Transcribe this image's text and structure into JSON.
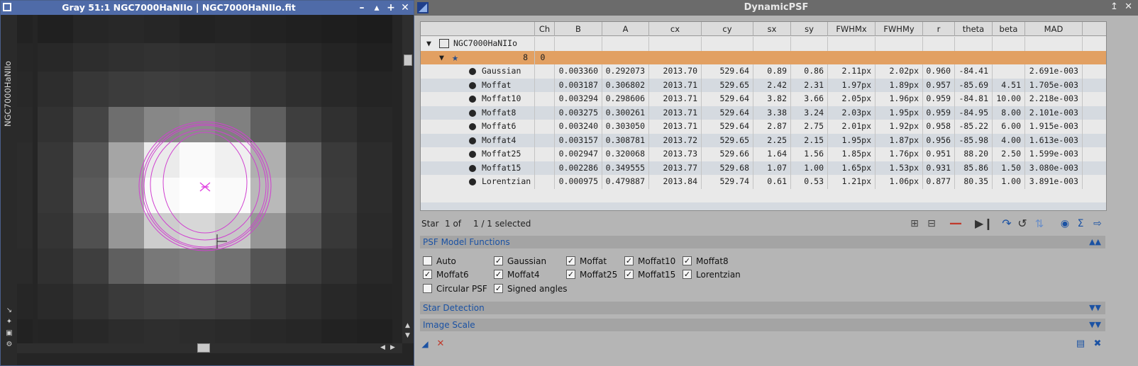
{
  "image_window": {
    "title": "Gray 51:1 NGC7000HaNIIo | NGC7000HaNIIo.fit",
    "view_id": "NGC7000HaNIIo",
    "buttons": {
      "minimize": "–",
      "shade": "▴",
      "maximize": "+",
      "close": "✕"
    }
  },
  "psf_window": {
    "title": "DynamicPSF",
    "columns": [
      "",
      "Ch",
      "B",
      "A",
      "cx",
      "cy",
      "sx",
      "sy",
      "FWHMx",
      "FWHMy",
      "r",
      "theta",
      "beta",
      "MAD"
    ],
    "tree": {
      "image_label": "NGC7000HaNIIo",
      "star_row": {
        "index": "8",
        "channel": "0"
      }
    },
    "rows": [
      {
        "name": "Gaussian",
        "B": "0.003360",
        "A": "0.292073",
        "cx": "2013.70",
        "cy": "529.64",
        "sx": "0.89",
        "sy": "0.86",
        "FWHMx": "2.11px",
        "FWHMy": "2.02px",
        "r": "0.960",
        "theta": "-84.41",
        "beta": "",
        "MAD": "2.691e-003"
      },
      {
        "name": "Moffat",
        "B": "0.003187",
        "A": "0.306802",
        "cx": "2013.71",
        "cy": "529.65",
        "sx": "2.42",
        "sy": "2.31",
        "FWHMx": "1.97px",
        "FWHMy": "1.89px",
        "r": "0.957",
        "theta": "-85.69",
        "beta": "4.51",
        "MAD": "1.705e-003"
      },
      {
        "name": "Moffat10",
        "B": "0.003294",
        "A": "0.298606",
        "cx": "2013.71",
        "cy": "529.64",
        "sx": "3.82",
        "sy": "3.66",
        "FWHMx": "2.05px",
        "FWHMy": "1.96px",
        "r": "0.959",
        "theta": "-84.81",
        "beta": "10.00",
        "MAD": "2.218e-003"
      },
      {
        "name": "Moffat8",
        "B": "0.003275",
        "A": "0.300261",
        "cx": "2013.71",
        "cy": "529.64",
        "sx": "3.38",
        "sy": "3.24",
        "FWHMx": "2.03px",
        "FWHMy": "1.95px",
        "r": "0.959",
        "theta": "-84.95",
        "beta": "8.00",
        "MAD": "2.101e-003"
      },
      {
        "name": "Moffat6",
        "B": "0.003240",
        "A": "0.303050",
        "cx": "2013.71",
        "cy": "529.64",
        "sx": "2.87",
        "sy": "2.75",
        "FWHMx": "2.01px",
        "FWHMy": "1.92px",
        "r": "0.958",
        "theta": "-85.22",
        "beta": "6.00",
        "MAD": "1.915e-003"
      },
      {
        "name": "Moffat4",
        "B": "0.003157",
        "A": "0.308781",
        "cx": "2013.72",
        "cy": "529.65",
        "sx": "2.25",
        "sy": "2.15",
        "FWHMx": "1.95px",
        "FWHMy": "1.87px",
        "r": "0.956",
        "theta": "-85.98",
        "beta": "4.00",
        "MAD": "1.613e-003"
      },
      {
        "name": "Moffat25",
        "B": "0.002947",
        "A": "0.320068",
        "cx": "2013.73",
        "cy": "529.66",
        "sx": "1.64",
        "sy": "1.56",
        "FWHMx": "1.85px",
        "FWHMy": "1.76px",
        "r": "0.951",
        "theta": "88.20",
        "beta": "2.50",
        "MAD": "1.599e-003"
      },
      {
        "name": "Moffat15",
        "B": "0.002286",
        "A": "0.349555",
        "cx": "2013.77",
        "cy": "529.68",
        "sx": "1.07",
        "sy": "1.00",
        "FWHMx": "1.65px",
        "FWHMy": "1.53px",
        "r": "0.931",
        "theta": "85.86",
        "beta": "1.50",
        "MAD": "3.080e-003"
      },
      {
        "name": "Lorentzian",
        "B": "0.000975",
        "A": "0.479887",
        "cx": "2013.84",
        "cy": "529.74",
        "sx": "0.61",
        "sy": "0.53",
        "FWHMx": "1.21px",
        "FWHMy": "1.06px",
        "r": "0.877",
        "theta": "80.35",
        "beta": "1.00",
        "MAD": "3.891e-003"
      }
    ],
    "status": {
      "star_label": "Star",
      "position": "1 of",
      "selection": "1 / 1 selected"
    },
    "sections": {
      "psf_model_functions": "PSF Model Functions",
      "star_detection": "Star Detection",
      "image_scale": "Image Scale"
    },
    "checkboxes": [
      {
        "label": "Auto",
        "checked": false
      },
      {
        "label": "Gaussian",
        "checked": true
      },
      {
        "label": "Moffat",
        "checked": true
      },
      {
        "label": "Moffat10",
        "checked": true
      },
      {
        "label": "Moffat8",
        "checked": true
      },
      {
        "label": "Moffat6",
        "checked": true
      },
      {
        "label": "Moffat4",
        "checked": true
      },
      {
        "label": "Moffat25",
        "checked": true
      },
      {
        "label": "Moffat15",
        "checked": true
      },
      {
        "label": "Lorentzian",
        "checked": true
      },
      {
        "label": "Circular PSF",
        "checked": false
      },
      {
        "label": "Signed angles",
        "checked": true
      }
    ],
    "colors": {
      "selected_row": "#e2a062",
      "accent": "#1b52a3",
      "psf_overlay": "#d040d0"
    }
  }
}
